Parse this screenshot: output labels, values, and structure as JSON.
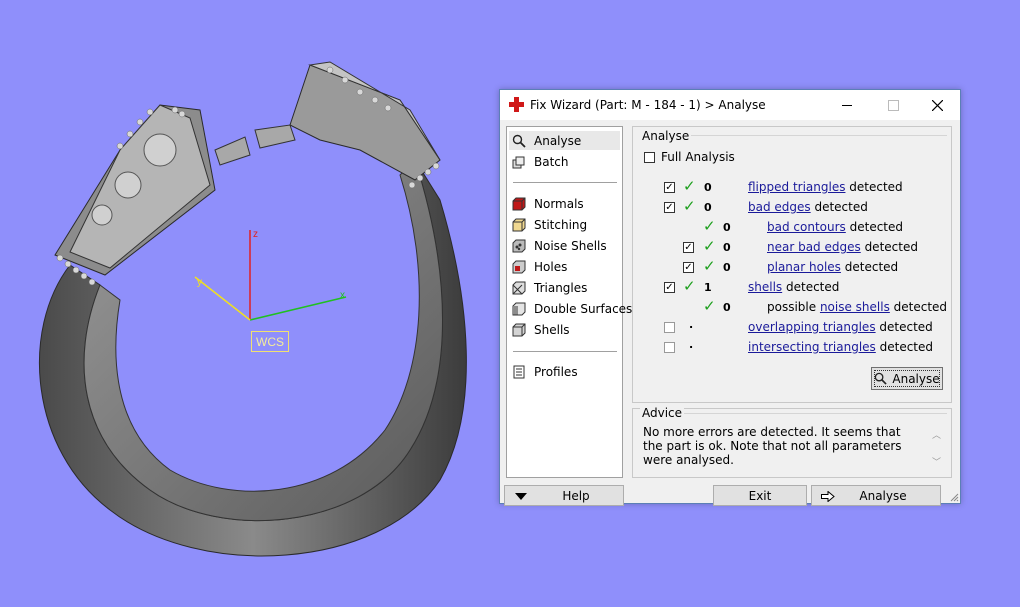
{
  "viewport": {
    "background_color": "#8f8ffb",
    "wcs_label": "WCS",
    "axis_z": "z",
    "axis_x": "x",
    "axis_y": "y"
  },
  "dialog": {
    "title": "Fix Wizard (Part: M - 184 - 1) > Analyse",
    "nav": [
      {
        "label": "Analyse",
        "icon": "magnifier-icon"
      },
      {
        "label": "Batch",
        "icon": "batch-icon"
      },
      {
        "label": "Normals",
        "icon": "normals-cube-icon"
      },
      {
        "label": "Stitching",
        "icon": "stitching-cube-icon"
      },
      {
        "label": "Noise Shells",
        "icon": "noise-shells-icon"
      },
      {
        "label": "Holes",
        "icon": "holes-cube-icon"
      },
      {
        "label": "Triangles",
        "icon": "triangles-cube-icon"
      },
      {
        "label": "Double Surfaces",
        "icon": "double-surfaces-icon"
      },
      {
        "label": "Shells",
        "icon": "shells-cube-icon"
      },
      {
        "label": "Profiles",
        "icon": "profiles-icon"
      }
    ],
    "analyse_group": {
      "title": "Analyse",
      "full_analysis_label": "Full Analysis",
      "rows": [
        {
          "count": "0",
          "link": "flipped triangles",
          "suffix": " detected",
          "prefix": ""
        },
        {
          "count": "0",
          "link": "bad edges",
          "suffix": " detected",
          "prefix": ""
        },
        {
          "count": "0",
          "link": "bad contours",
          "suffix": " detected",
          "prefix": ""
        },
        {
          "count": "0",
          "link": "near bad edges",
          "suffix": " detected",
          "prefix": ""
        },
        {
          "count": "0",
          "link": "planar holes",
          "suffix": " detected",
          "prefix": ""
        },
        {
          "count": "1",
          "link": "shells",
          "suffix": " detected",
          "prefix": ""
        },
        {
          "count": "0",
          "link": "noise shells",
          "suffix": " detected",
          "prefix": "possible "
        },
        {
          "count": ".",
          "link": "overlapping triangles",
          "suffix": " detected",
          "prefix": ""
        },
        {
          "count": ".",
          "link": "intersecting triangles",
          "suffix": " detected",
          "prefix": ""
        }
      ],
      "analyse_button": "Analyse"
    },
    "advice_group": {
      "title": "Advice",
      "text": "No more errors are detected. It seems that the part is ok. Note that not all parameters were analysed."
    },
    "buttons": {
      "help": "Help",
      "exit": "Exit",
      "analyse": "Analyse"
    }
  }
}
